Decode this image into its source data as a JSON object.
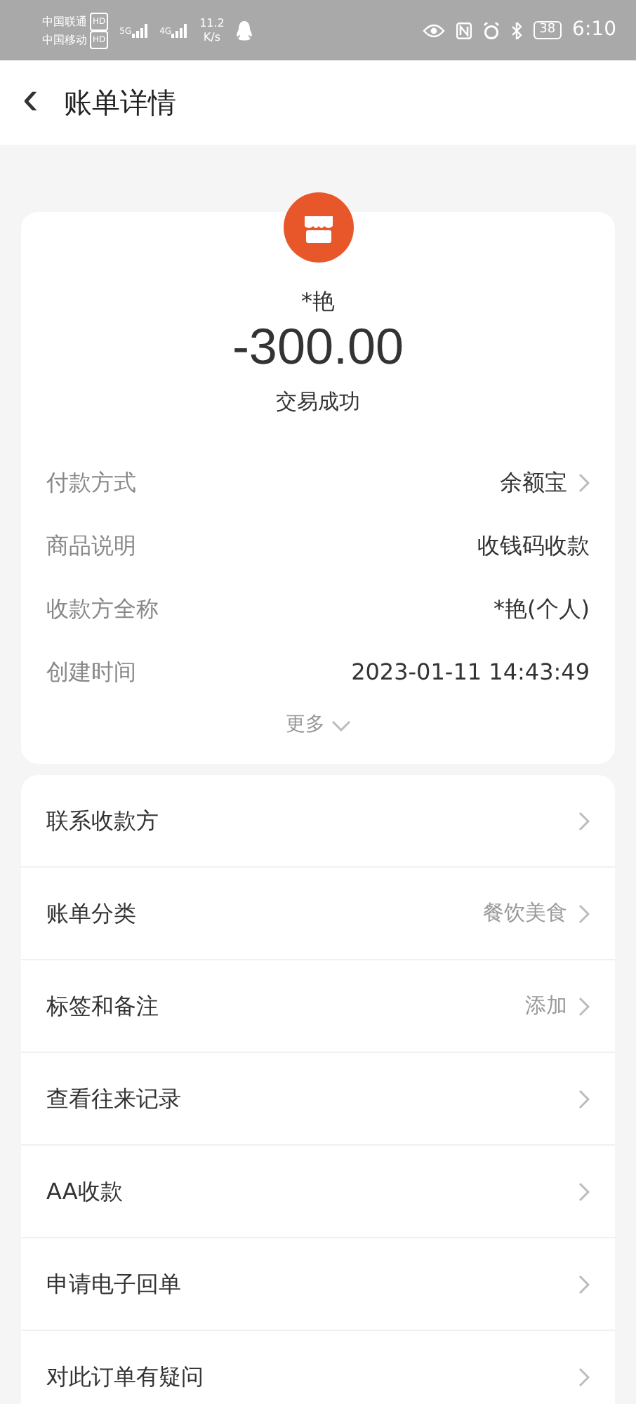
{
  "status_bar": {
    "carriers": [
      {
        "name": "中国联通",
        "badge": "HD",
        "network": "5G"
      },
      {
        "name": "中国移动",
        "badge": "HD",
        "network": "4G"
      }
    ],
    "speed": "11.2",
    "speed_unit": "K/s",
    "battery": "38",
    "time": "6:10"
  },
  "header": {
    "back": "‹",
    "title": "账单详情"
  },
  "summary": {
    "payee": "*艳",
    "amount": "-300.00",
    "status": "交易成功"
  },
  "details": [
    {
      "label": "付款方式",
      "value": "余额宝",
      "chevron": true
    },
    {
      "label": "商品说明",
      "value": "收钱码收款",
      "chevron": false
    },
    {
      "label": "收款方全称",
      "value": "*艳(个人)",
      "chevron": false
    },
    {
      "label": "创建时间",
      "value": "2023-01-11 14:43:49",
      "chevron": false
    }
  ],
  "more": "更多",
  "actions": [
    {
      "label": "联系收款方",
      "chevron": true
    },
    {
      "label": "账单分类",
      "value": "餐饮美食",
      "chevron": true
    },
    {
      "label": "标签和备注",
      "value": "添加",
      "chevron": true
    },
    {
      "label": "查看往来记录",
      "chevron": true
    },
    {
      "label": "AA收款",
      "chevron": true
    },
    {
      "label": "申请电子回单",
      "chevron": true
    },
    {
      "label": "对此订单有疑问",
      "chevron": true
    }
  ]
}
